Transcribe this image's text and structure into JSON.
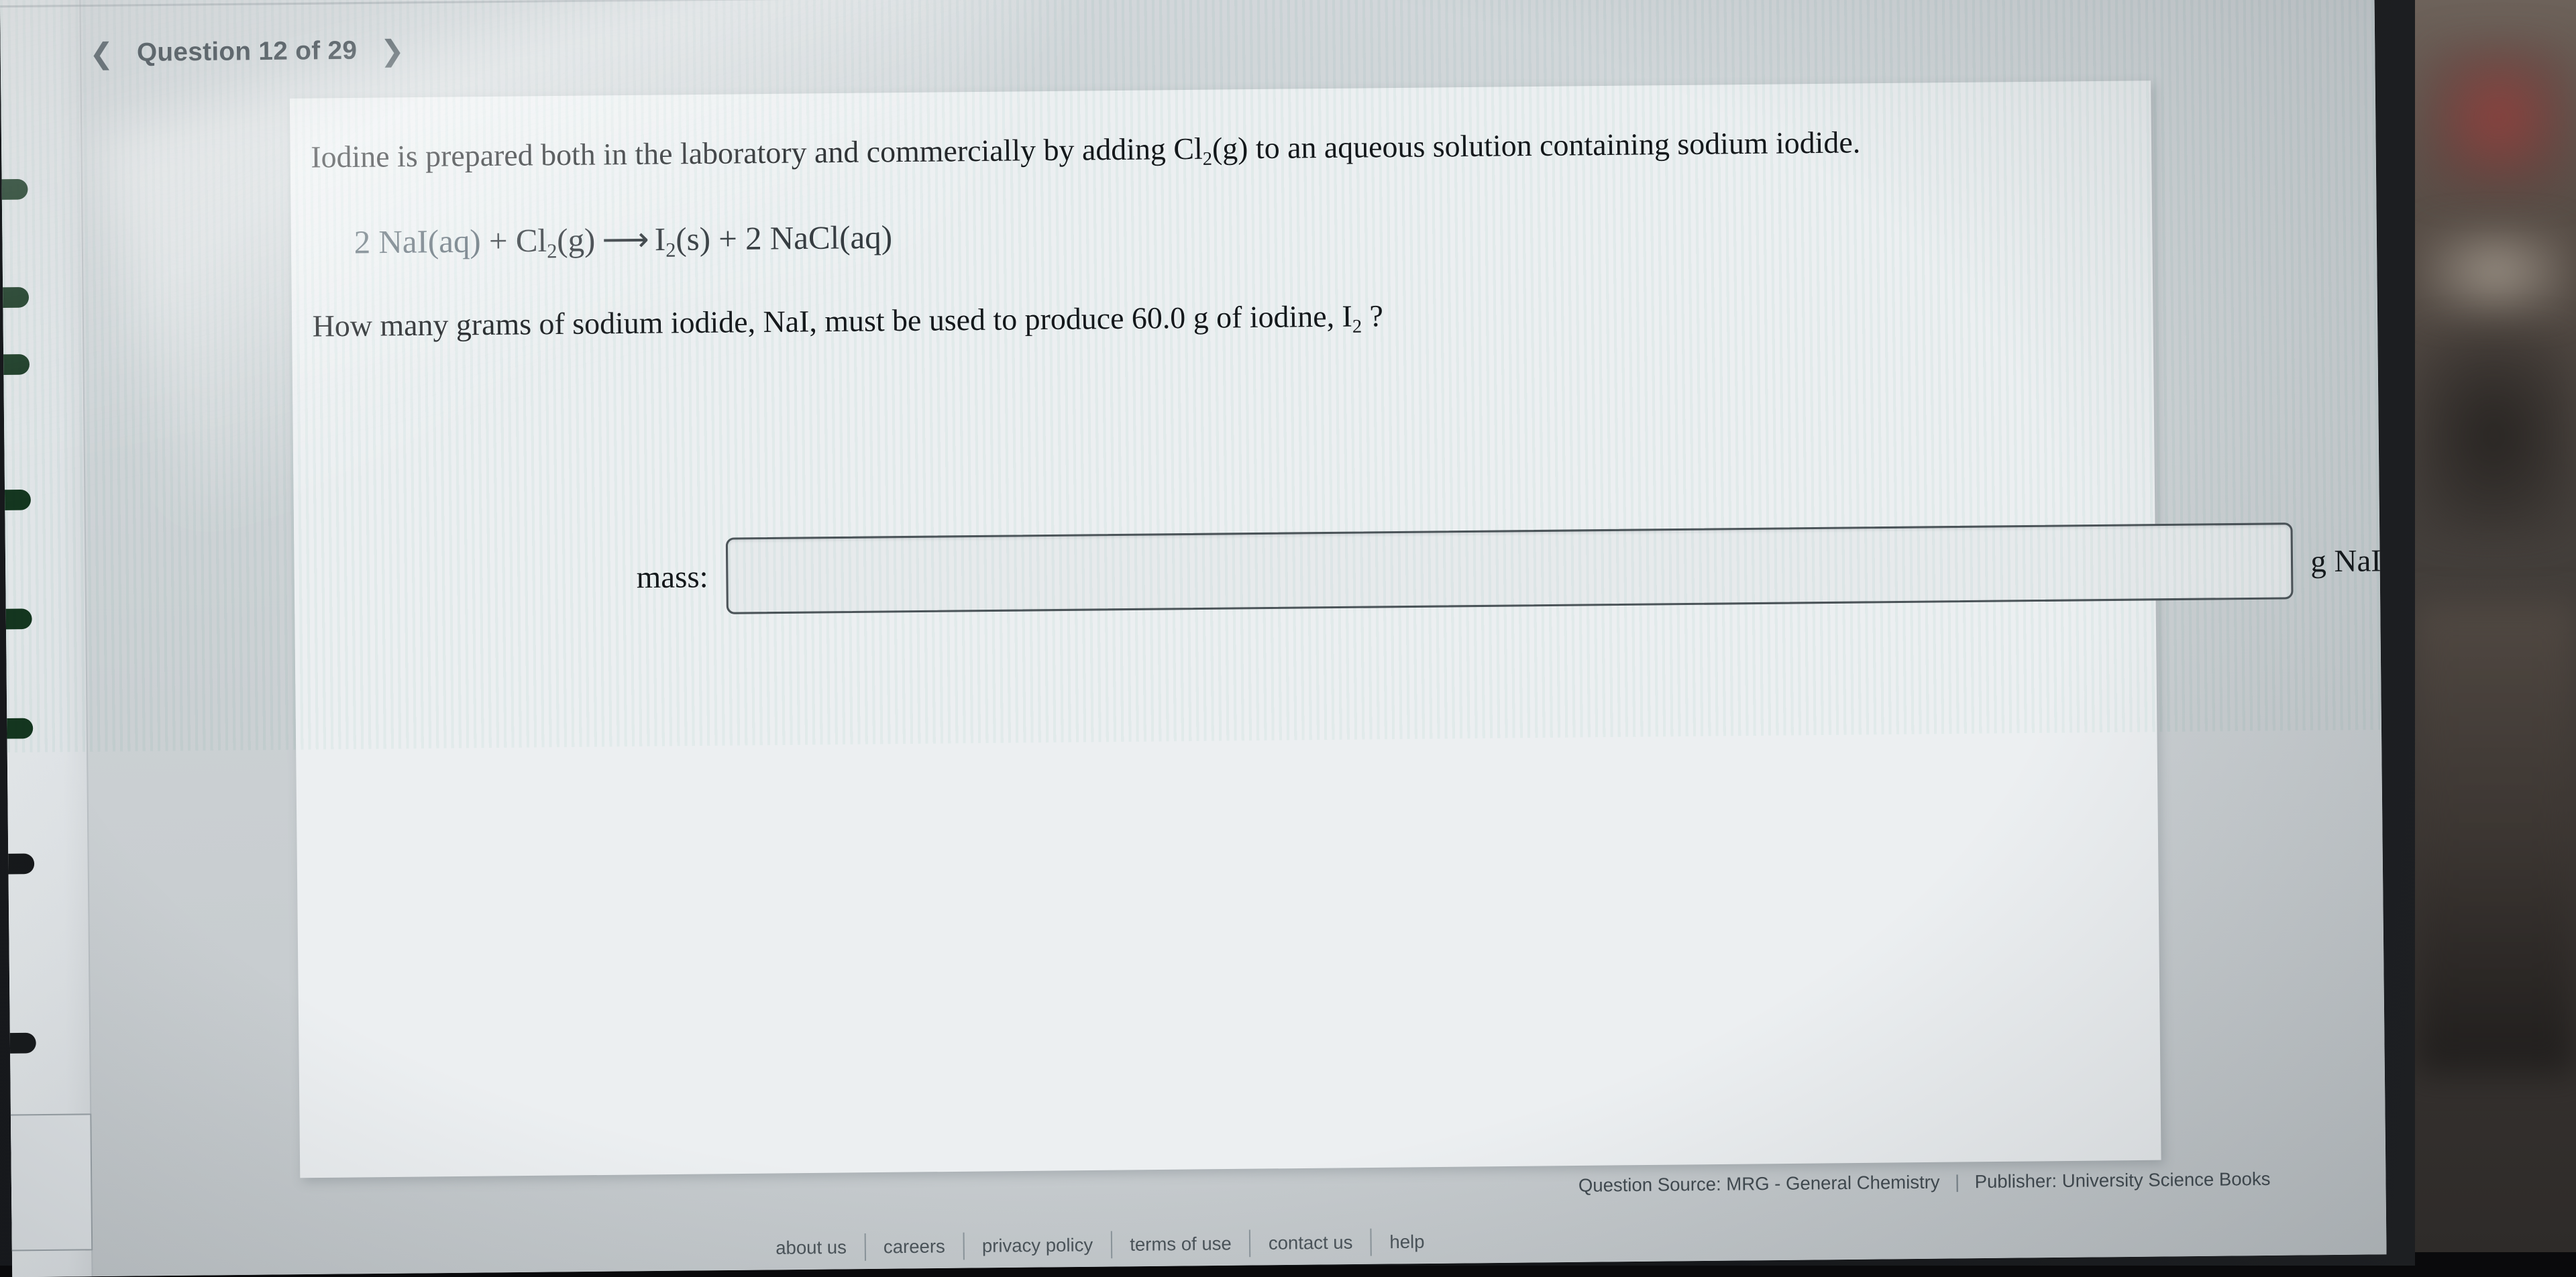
{
  "nav": {
    "prev_icon": "chevron-left-icon",
    "next_icon": "chevron-right-icon",
    "title": "Question 12 of 29"
  },
  "question": {
    "stem_part1": "Iodine is prepared both in the laboratory and commercially by adding Cl",
    "stem_sub1": "2",
    "stem_part2": "(g) to an aqueous solution containing sodium iodide.",
    "equation": {
      "reactant_coefficient": "2 ",
      "reactant_1": "NaI(aq)",
      "plus_1": " + ",
      "reactant_2_formula": "Cl",
      "reactant_2_sub": "2",
      "reactant_2_state": "(g)",
      "arrow": "⟶",
      "product_1_formula": "I",
      "product_1_sub": "2",
      "product_1_state": "(s)",
      "plus_2": " + ",
      "product_2": "2 NaCl(aq)",
      "full_text": "2 NaI(aq) + Cl2(g) ⟶ I2(s) + 2 NaCl(aq)"
    },
    "ask_part1": "How many grams of sodium iodide, NaI, must be used to produce 60.0 g of iodine, I",
    "ask_sub": "2",
    "ask_part2": " ?"
  },
  "answer": {
    "label": "mass:",
    "value": "",
    "placeholder": "",
    "unit": "g NaI"
  },
  "attribution": {
    "source": "Question Source: MRG - General Chemistry",
    "separator": "|",
    "publisher": "Publisher: University Science Books"
  },
  "footer": {
    "links": [
      "about us",
      "careers",
      "privacy policy",
      "terms of use",
      "contact us",
      "help"
    ]
  },
  "colors": {
    "page_background": "#c9ced1",
    "card_background": "#eceff1",
    "text": "#14181b",
    "header_text": "#26323a",
    "input_border": "#4c5459",
    "sidebar_pill": "#14361f",
    "bezel": "#17191c"
  }
}
